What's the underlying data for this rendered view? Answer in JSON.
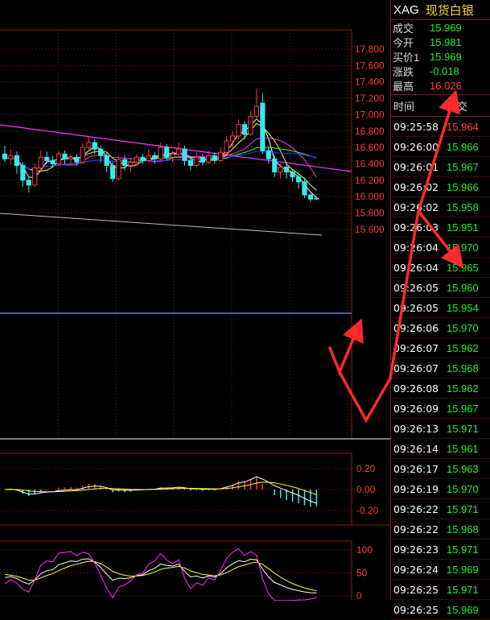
{
  "panel": {
    "code": "XAG",
    "name": "现货白银",
    "quote": [
      {
        "label": "成交",
        "value": "15.969",
        "color": "dn"
      },
      {
        "label": "今开",
        "value": "15.981",
        "color": "dn"
      },
      {
        "label": "买价1",
        "value": "15.969",
        "color": "dn"
      },
      {
        "label": "涨跌",
        "value": "-0.018",
        "color": "dn"
      },
      {
        "label": "最高",
        "value": "16.026",
        "color": "up"
      }
    ],
    "ticks_header": {
      "time": "时间",
      "price": "成交"
    },
    "ticks": [
      {
        "time": "09:25:58",
        "price": "15.964"
      },
      {
        "time": "09:26:00",
        "price": "15.966"
      },
      {
        "time": "09:26:01",
        "price": "15.967"
      },
      {
        "time": "09:26:02",
        "price": "15.966"
      },
      {
        "time": "09:26:02",
        "price": "15.958"
      },
      {
        "time": "09:26:03",
        "price": "15.951"
      },
      {
        "time": "09:26:04",
        "price": "15.970"
      },
      {
        "time": "09:26:04",
        "price": "15.965"
      },
      {
        "time": "09:26:05",
        "price": "15.960"
      },
      {
        "time": "09:26:05",
        "price": "15.954"
      },
      {
        "time": "09:26:06",
        "price": "15.970"
      },
      {
        "time": "09:26:07",
        "price": "15.962"
      },
      {
        "time": "09:26:07",
        "price": "15.968"
      },
      {
        "time": "09:26:08",
        "price": "15.962"
      },
      {
        "time": "09:26:09",
        "price": "15.967"
      },
      {
        "time": "09:26:13",
        "price": "15.971"
      },
      {
        "time": "09:26:14",
        "price": "15.961"
      },
      {
        "time": "09:26:17",
        "price": "15.963"
      },
      {
        "time": "09:26:19",
        "price": "15.970"
      },
      {
        "time": "09:26:22",
        "price": "15.971"
      },
      {
        "time": "09:26:22",
        "price": "15.968"
      },
      {
        "time": "09:26:23",
        "price": "15.971"
      },
      {
        "time": "09:26:24",
        "price": "15.969"
      },
      {
        "time": "09:26:25",
        "price": "15.971"
      },
      {
        "time": "09:26:25",
        "price": "15.969"
      }
    ]
  },
  "chart_data": {
    "type": "candlestick",
    "price_axis": [
      "17.800",
      "17.600",
      "17.400",
      "17.200",
      "17.000",
      "16.800",
      "16.600",
      "16.400",
      "16.200",
      "16.000",
      "15.800",
      "15.600"
    ],
    "macd_axis": [
      "0.20",
      "0.00",
      "-0.20"
    ],
    "kdj_axis": [
      "100",
      "50",
      "0"
    ],
    "colors": {
      "up": "#ff3b3b",
      "down": "#38e8ee",
      "grid": "#8b1a1a",
      "ma1": "#ffffff",
      "ma2": "#ffff33",
      "ma3": "#ff33ff",
      "ma4": "#33ff33",
      "ma5": "#3333ff",
      "trend": "#ff33ff",
      "arrows": "#ff2a2a"
    },
    "candles": [
      {
        "o": 16.52,
        "c": 16.46,
        "h": 16.62,
        "l": 16.42
      },
      {
        "o": 16.46,
        "c": 16.5,
        "h": 16.58,
        "l": 16.4
      },
      {
        "o": 16.5,
        "c": 16.38,
        "h": 16.55,
        "l": 16.28
      },
      {
        "o": 16.38,
        "c": 16.2,
        "h": 16.42,
        "l": 16.12
      },
      {
        "o": 16.2,
        "c": 16.14,
        "h": 16.25,
        "l": 16.05
      },
      {
        "o": 16.14,
        "c": 16.35,
        "h": 16.4,
        "l": 16.12
      },
      {
        "o": 16.35,
        "c": 16.48,
        "h": 16.56,
        "l": 16.3
      },
      {
        "o": 16.48,
        "c": 16.44,
        "h": 16.55,
        "l": 16.4
      },
      {
        "o": 16.44,
        "c": 16.4,
        "h": 16.5,
        "l": 16.35
      },
      {
        "o": 16.4,
        "c": 16.52,
        "h": 16.56,
        "l": 16.38
      },
      {
        "o": 16.52,
        "c": 16.46,
        "h": 16.56,
        "l": 16.4
      },
      {
        "o": 16.46,
        "c": 16.48,
        "h": 16.52,
        "l": 16.4
      },
      {
        "o": 16.48,
        "c": 16.42,
        "h": 16.52,
        "l": 16.38
      },
      {
        "o": 16.42,
        "c": 16.6,
        "h": 16.65,
        "l": 16.4
      },
      {
        "o": 16.6,
        "c": 16.66,
        "h": 16.74,
        "l": 16.56
      },
      {
        "o": 16.66,
        "c": 16.58,
        "h": 16.7,
        "l": 16.52
      },
      {
        "o": 16.58,
        "c": 16.5,
        "h": 16.62,
        "l": 16.42
      },
      {
        "o": 16.5,
        "c": 16.38,
        "h": 16.54,
        "l": 16.3
      },
      {
        "o": 16.38,
        "c": 16.22,
        "h": 16.42,
        "l": 16.18
      },
      {
        "o": 16.22,
        "c": 16.45,
        "h": 16.5,
        "l": 16.2
      },
      {
        "o": 16.45,
        "c": 16.38,
        "h": 16.5,
        "l": 16.32
      },
      {
        "o": 16.38,
        "c": 16.42,
        "h": 16.46,
        "l": 16.3
      },
      {
        "o": 16.42,
        "c": 16.48,
        "h": 16.52,
        "l": 16.38
      },
      {
        "o": 16.48,
        "c": 16.44,
        "h": 16.52,
        "l": 16.4
      },
      {
        "o": 16.44,
        "c": 16.5,
        "h": 16.58,
        "l": 16.42
      },
      {
        "o": 16.5,
        "c": 16.46,
        "h": 16.54,
        "l": 16.4
      },
      {
        "o": 16.46,
        "c": 16.6,
        "h": 16.66,
        "l": 16.44
      },
      {
        "o": 16.6,
        "c": 16.48,
        "h": 16.64,
        "l": 16.44
      },
      {
        "o": 16.48,
        "c": 16.52,
        "h": 16.56,
        "l": 16.42
      },
      {
        "o": 16.52,
        "c": 16.58,
        "h": 16.66,
        "l": 16.5
      },
      {
        "o": 16.58,
        "c": 16.44,
        "h": 16.62,
        "l": 16.38
      },
      {
        "o": 16.44,
        "c": 16.38,
        "h": 16.5,
        "l": 16.32
      },
      {
        "o": 16.38,
        "c": 16.48,
        "h": 16.54,
        "l": 16.36
      },
      {
        "o": 16.48,
        "c": 16.42,
        "h": 16.52,
        "l": 16.38
      },
      {
        "o": 16.42,
        "c": 16.5,
        "h": 16.56,
        "l": 16.4
      },
      {
        "o": 16.5,
        "c": 16.44,
        "h": 16.54,
        "l": 16.4
      },
      {
        "o": 16.44,
        "c": 16.54,
        "h": 16.6,
        "l": 16.42
      },
      {
        "o": 16.54,
        "c": 16.68,
        "h": 16.74,
        "l": 16.52
      },
      {
        "o": 16.68,
        "c": 16.74,
        "h": 16.8,
        "l": 16.6
      },
      {
        "o": 16.74,
        "c": 16.88,
        "h": 16.94,
        "l": 16.7
      },
      {
        "o": 16.88,
        "c": 16.76,
        "h": 16.92,
        "l": 16.7
      },
      {
        "o": 16.76,
        "c": 16.98,
        "h": 17.04,
        "l": 16.74
      },
      {
        "o": 16.98,
        "c": 17.1,
        "h": 17.32,
        "l": 16.94
      },
      {
        "o": 17.14,
        "c": 16.56,
        "h": 17.26,
        "l": 16.52
      },
      {
        "o": 16.56,
        "c": 16.46,
        "h": 16.62,
        "l": 16.4
      },
      {
        "o": 16.46,
        "c": 16.3,
        "h": 16.5,
        "l": 16.24
      },
      {
        "o": 16.3,
        "c": 16.36,
        "h": 16.4,
        "l": 16.22
      },
      {
        "o": 16.36,
        "c": 16.3,
        "h": 16.42,
        "l": 16.22
      },
      {
        "o": 16.3,
        "c": 16.24,
        "h": 16.34,
        "l": 16.18
      },
      {
        "o": 16.24,
        "c": 16.18,
        "h": 16.3,
        "l": 16.1
      },
      {
        "o": 16.18,
        "c": 16.02,
        "h": 16.22,
        "l": 15.98
      },
      {
        "o": 16.02,
        "c": 15.97,
        "h": 16.04,
        "l": 15.93
      },
      {
        "o": 15.98,
        "c": 15.97,
        "h": 16.0,
        "l": 15.96
      }
    ]
  }
}
